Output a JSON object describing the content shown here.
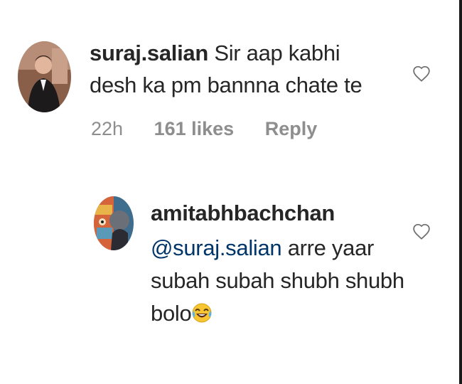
{
  "comments": [
    {
      "username": "suraj.salian",
      "text": "Sir aap kabhi desh ka pm bannna chate te",
      "time": "22h",
      "likes": "161 likes",
      "reply_label": "Reply"
    }
  ],
  "reply": {
    "username": "amitabhbachchan",
    "mention": "@suraj.salian",
    "text": " arre yaar subah subah shubh shubh bolo",
    "emoji": "laughing-tears-emoji"
  },
  "icons": {
    "like": "heart-outline-icon"
  },
  "colors": {
    "text": "#262626",
    "muted": "#8e8e8e",
    "mention": "#003569"
  }
}
